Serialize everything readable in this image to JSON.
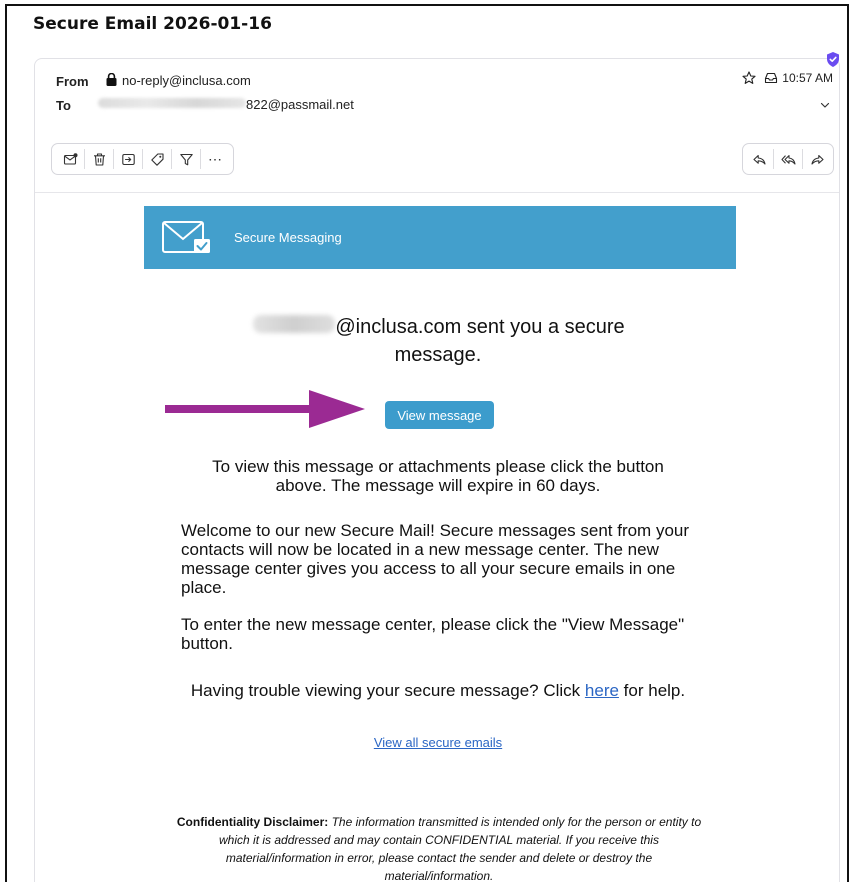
{
  "subject": "Secure Email 2026-01-16",
  "header": {
    "from_label": "From",
    "from_value": "no-reply@inclusa.com",
    "to_label": "To",
    "to_value": "822@passmail.net",
    "time": "10:57 AM"
  },
  "toolbar": {
    "left_icons": [
      "envelope-dot-icon",
      "trash-icon",
      "move-to-icon",
      "tag-icon",
      "filter-icon",
      "more-icon"
    ],
    "more_label": "⋯",
    "right_icons": [
      "reply-icon",
      "reply-all-icon",
      "forward-icon"
    ]
  },
  "banner": {
    "title": "Secure Messaging",
    "color": "#439fcc"
  },
  "body": {
    "sent_line1": "@inclusa.com sent you a secure",
    "sent_line2": "message.",
    "view_button": "View message",
    "expire_line1": "To view this message or attachments please click the button",
    "expire_line2": "above. The message will expire in 60 days.",
    "welcome_line1": "Welcome to our new Secure Mail! Secure messages sent from your",
    "welcome_line2": "contacts will now be located in a new message center. The new",
    "welcome_line3": "message center gives you access to all your secure emails in one",
    "welcome_line4": "place.",
    "enter_line1": "To enter the new message center, please click the \"View Message\"",
    "enter_line2": "button.",
    "trouble_prefix": "Having trouble viewing your secure message? Click",
    "trouble_link": "here",
    "trouble_suffix": "for help.",
    "view_all_link": "View all secure emails"
  },
  "disclaimer": {
    "label": "Confidentiality Disclaimer:",
    "line1": "The information transmitted is intended only for the person or entity to",
    "line2": "which it is addressed and may contain CONFIDENTIAL material. If you receive this",
    "line3": "material/information in error, please contact the sender and delete or destroy the",
    "line4": "material/information."
  },
  "colors": {
    "accent": "#439fcc",
    "arrow": "#9b2a93",
    "link": "#2b66c4",
    "shield": "#6a4cf0"
  }
}
